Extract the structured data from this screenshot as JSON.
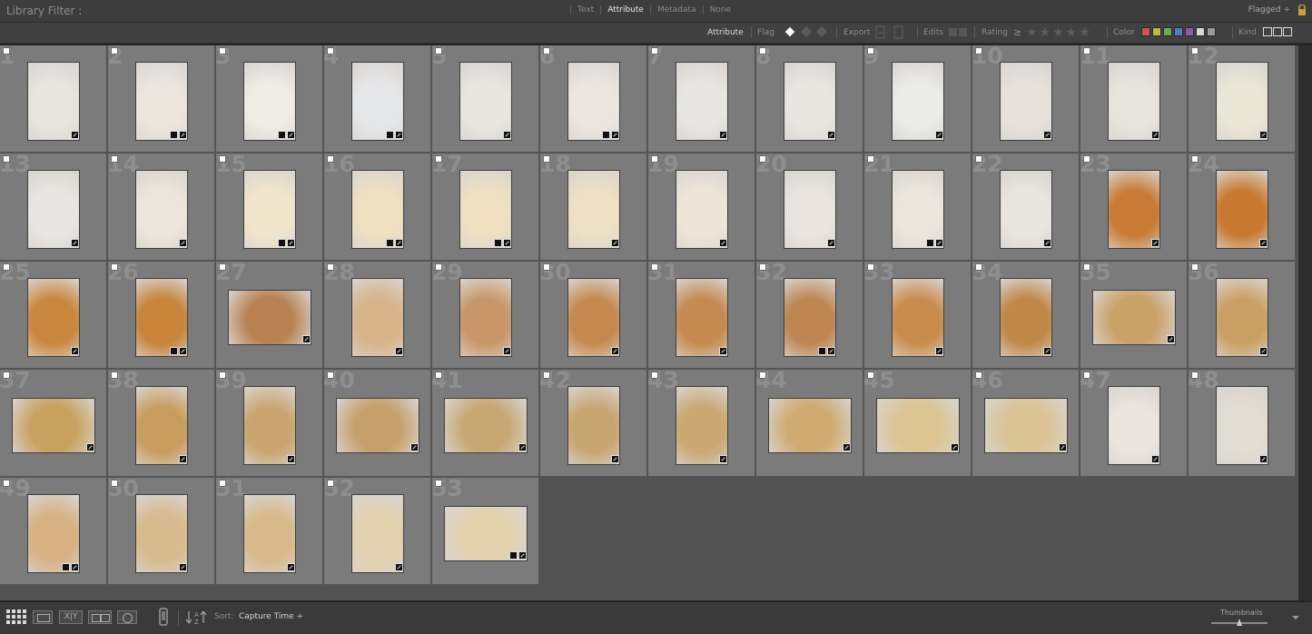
{
  "library_filter": {
    "title": "Library Filter :",
    "tabs": [
      "Text",
      "Attribute",
      "Metadata",
      "None"
    ],
    "active_tab": "Attribute",
    "preset": "Flagged ÷"
  },
  "attribute_bar": {
    "attribute_label": "Attribute",
    "flag_label": "Flag",
    "export_label": "Export",
    "edits_label": "Edits",
    "rating_label": "Rating",
    "rating_op": "≥",
    "color_label": "Color",
    "kind_label": "Kind",
    "color_swatches": [
      "#c9555b",
      "#c4b446",
      "#6bab55",
      "#4f7fc0",
      "#8b5ba8",
      "#d8d8d8",
      "#9a9a9a"
    ]
  },
  "toolbar": {
    "sort_label": "Sort:",
    "sort_value": "Capture Time ÷",
    "thumbnails_label": "Thumbnails",
    "thumbnail_size": 0.5
  },
  "grid": {
    "photos": [
      {
        "n": "1",
        "o": "p",
        "c": "#e8e4de",
        "b": 1
      },
      {
        "n": "2",
        "o": "p",
        "c": "#ece6df",
        "b": 2
      },
      {
        "n": "3",
        "o": "p",
        "c": "#efece6",
        "b": 2
      },
      {
        "n": "4",
        "o": "p",
        "c": "#e6e7e9",
        "b": 2
      },
      {
        "n": "5",
        "o": "p",
        "c": "#e8e6e0",
        "b": 1
      },
      {
        "n": "6",
        "o": "p",
        "c": "#ece6e0",
        "b": 2
      },
      {
        "n": "7",
        "o": "p",
        "c": "#e8e6e2",
        "b": 1
      },
      {
        "n": "8",
        "o": "p",
        "c": "#e9e5df",
        "b": 1
      },
      {
        "n": "9",
        "o": "p",
        "c": "#ebebe9",
        "b": 1
      },
      {
        "n": "10",
        "o": "p",
        "c": "#e6e2db",
        "b": 1
      },
      {
        "n": "11",
        "o": "p",
        "c": "#e7e4dd",
        "b": 1
      },
      {
        "n": "12",
        "o": "p",
        "c": "#ebe6d6",
        "b": 1
      },
      {
        "n": "13",
        "o": "p",
        "c": "#e8e6e2",
        "b": 1
      },
      {
        "n": "14",
        "o": "p",
        "c": "#ede6da",
        "b": 1
      },
      {
        "n": "15",
        "o": "p",
        "c": "#f1e6cc",
        "b": 2
      },
      {
        "n": "16",
        "o": "p",
        "c": "#f0e0c2",
        "b": 2
      },
      {
        "n": "17",
        "o": "p",
        "c": "#efe0c2",
        "b": 2
      },
      {
        "n": "18",
        "o": "p",
        "c": "#eee0c4",
        "b": 1
      },
      {
        "n": "19",
        "o": "p",
        "c": "#ede6d8",
        "b": 1
      },
      {
        "n": "20",
        "o": "p",
        "c": "#e9e5de",
        "b": 1
      },
      {
        "n": "21",
        "o": "p",
        "c": "#ebe6de",
        "b": 2
      },
      {
        "n": "22",
        "o": "p",
        "c": "#e9e6e2",
        "b": 1
      },
      {
        "n": "23",
        "o": "p",
        "c": "#c97a34",
        "b": 1
      },
      {
        "n": "24",
        "o": "p",
        "c": "#c8792f",
        "b": 1
      },
      {
        "n": "25",
        "o": "p",
        "c": "#c9873d",
        "b": 1
      },
      {
        "n": "26",
        "o": "p",
        "c": "#c7843a",
        "b": 2
      },
      {
        "n": "27",
        "o": "l",
        "c": "#b88252",
        "b": 1
      },
      {
        "n": "28",
        "o": "p",
        "c": "#d7b48a",
        "b": 1
      },
      {
        "n": "29",
        "o": "p",
        "c": "#c89668",
        "b": 1
      },
      {
        "n": "30",
        "o": "p",
        "c": "#c5894f",
        "b": 1
      },
      {
        "n": "31",
        "o": "p",
        "c": "#c48a50",
        "b": 1
      },
      {
        "n": "32",
        "o": "p",
        "c": "#bd8651",
        "b": 2
      },
      {
        "n": "33",
        "o": "p",
        "c": "#c98b4c",
        "b": 1
      },
      {
        "n": "34",
        "o": "p",
        "c": "#c08847",
        "b": 1
      },
      {
        "n": "35",
        "o": "l",
        "c": "#caa166",
        "b": 1
      },
      {
        "n": "36",
        "o": "p",
        "c": "#c99f63",
        "b": 1
      },
      {
        "n": "37",
        "o": "l",
        "c": "#c9a15f",
        "b": 1
      },
      {
        "n": "38",
        "o": "p",
        "c": "#c89c5c",
        "b": 1
      },
      {
        "n": "39",
        "o": "p",
        "c": "#c9a670",
        "b": 1
      },
      {
        "n": "40",
        "o": "l",
        "c": "#c6a06a",
        "b": 1
      },
      {
        "n": "41",
        "o": "l",
        "c": "#c8a872",
        "b": 1
      },
      {
        "n": "42",
        "o": "p",
        "c": "#c8a672",
        "b": 1
      },
      {
        "n": "43",
        "o": "p",
        "c": "#caa872",
        "b": 1
      },
      {
        "n": "44",
        "o": "l",
        "c": "#cfab71",
        "b": 1
      },
      {
        "n": "45",
        "o": "l",
        "c": "#dcc592",
        "b": 1
      },
      {
        "n": "46",
        "o": "l",
        "c": "#dac496",
        "b": 1
      },
      {
        "n": "47",
        "o": "p",
        "c": "#ebe5e0",
        "b": 1
      },
      {
        "n": "48",
        "o": "p",
        "c": "#e2dcd3",
        "b": 1
      },
      {
        "n": "49",
        "o": "p",
        "c": "#d7b284",
        "b": 2
      },
      {
        "n": "50",
        "o": "p",
        "c": "#d7ba8d",
        "b": 1
      },
      {
        "n": "51",
        "o": "p",
        "c": "#d8b98b",
        "b": 1
      },
      {
        "n": "52",
        "o": "p",
        "c": "#e2d1ae",
        "b": 1
      },
      {
        "n": "53",
        "o": "l",
        "c": "#e3d2ae",
        "b": 2
      }
    ]
  }
}
